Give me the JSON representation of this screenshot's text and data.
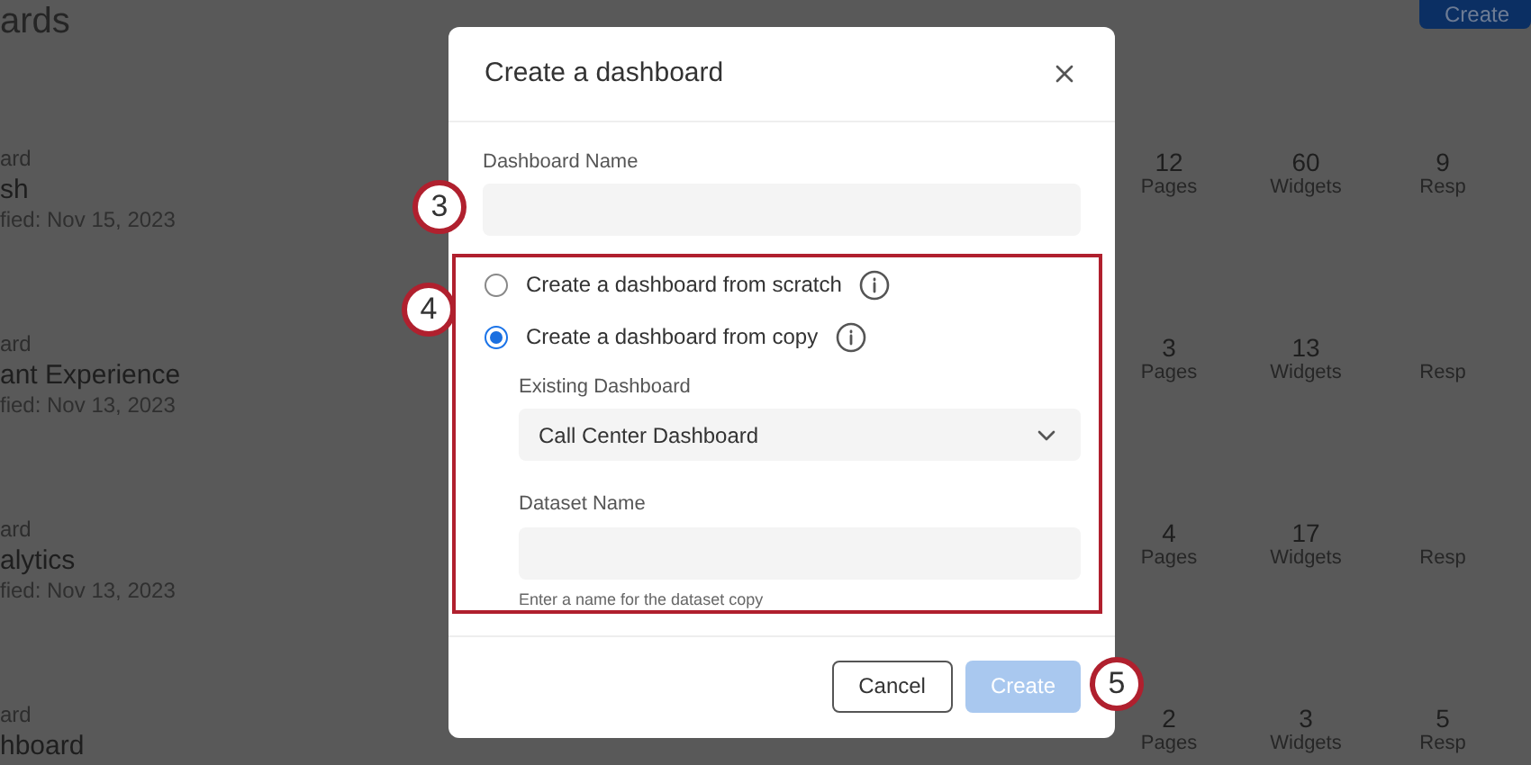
{
  "page": {
    "title": "ards",
    "create_button": "Create"
  },
  "rows": [
    {
      "type": "ard",
      "name": "sh",
      "modified": "fied: Nov 15, 2023",
      "stats": [
        {
          "value": "12",
          "label": "Pages"
        },
        {
          "value": "60",
          "label": "Widgets"
        },
        {
          "value": "9",
          "label": "Resp"
        }
      ]
    },
    {
      "type": "ard",
      "name": "ant Experience",
      "modified": "fied: Nov 13, 2023",
      "stats": [
        {
          "value": "3",
          "label": "Pages"
        },
        {
          "value": "13",
          "label": "Widgets"
        },
        {
          "label": "Resp"
        }
      ]
    },
    {
      "type": "ard",
      "name": "alytics",
      "modified": "fied: Nov 13, 2023",
      "stats": [
        {
          "value": "4",
          "label": "Pages"
        },
        {
          "value": "17",
          "label": "Widgets"
        },
        {
          "label": "Resp"
        }
      ]
    },
    {
      "type": "ard",
      "name": "hboard",
      "stats": [
        {
          "value": "2",
          "label": "Pages"
        },
        {
          "value": "3",
          "label": "Widgets"
        },
        {
          "value": "5",
          "label": "Resp"
        }
      ]
    }
  ],
  "dialog": {
    "title": "Create a dashboard",
    "name_field": {
      "label": "Dashboard Name"
    },
    "options": [
      {
        "label": "Create a dashboard from scratch",
        "selected": false
      },
      {
        "label": "Create a dashboard from copy",
        "selected": true
      }
    ],
    "existing_dashboard": {
      "label": "Existing Dashboard",
      "value": "Call Center Dashboard"
    },
    "dataset_field": {
      "label": "Dataset Name",
      "hint": "Enter a name for the dataset copy"
    },
    "buttons": [
      {
        "label": "Cancel",
        "kind": "secondary",
        "disabled": false
      },
      {
        "label": "Create",
        "kind": "primary",
        "disabled": true
      }
    ]
  },
  "steps": [
    "3",
    "4",
    "5"
  ]
}
